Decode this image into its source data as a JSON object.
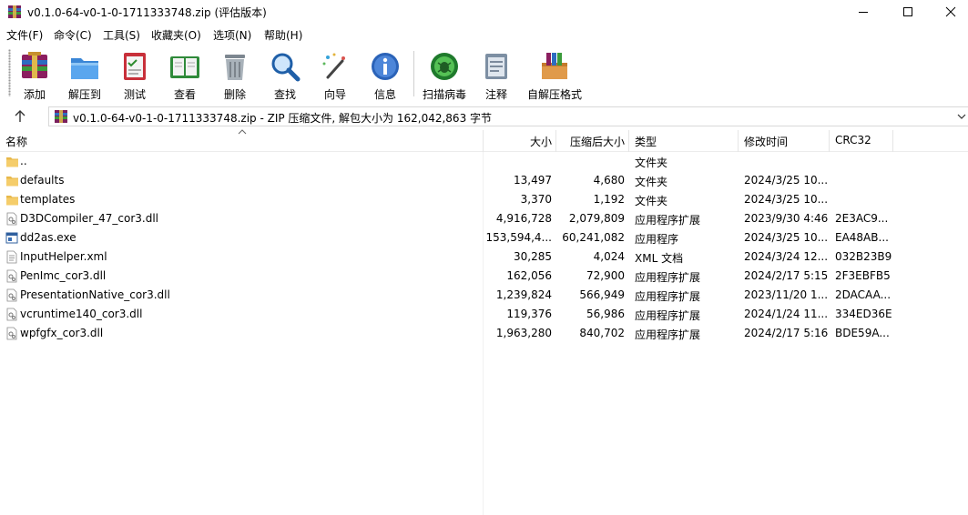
{
  "window": {
    "title": "v0.1.0-64-v0-1-0-1711333748.zip (评估版本)"
  },
  "menu": [
    "文件(F)",
    "命令(C)",
    "工具(S)",
    "收藏夹(O)",
    "选项(N)",
    "帮助(H)"
  ],
  "toolbar": {
    "add": "添加",
    "extract_to": "解压到",
    "test": "测试",
    "view": "查看",
    "delete": "删除",
    "find": "查找",
    "wizard": "向导",
    "info": "信息",
    "virus_scan": "扫描病毒",
    "comment": "注释",
    "sfx": "自解压格式"
  },
  "address": {
    "text": "v0.1.0-64-v0-1-0-1711333748.zip - ZIP 压缩文件, 解包大小为 162,042,863 字节"
  },
  "columns": {
    "name": "名称",
    "size": "大小",
    "packed": "压缩后大小",
    "type": "类型",
    "modified": "修改时间",
    "crc": "CRC32"
  },
  "files": [
    {
      "name": "..",
      "size": "",
      "packed": "",
      "type": "文件夹",
      "modified": "",
      "crc": "",
      "icon": "folder-icon"
    },
    {
      "name": "defaults",
      "size": "13,497",
      "packed": "4,680",
      "type": "文件夹",
      "modified": "2024/3/25 10...",
      "crc": "",
      "icon": "folder-icon"
    },
    {
      "name": "templates",
      "size": "3,370",
      "packed": "1,192",
      "type": "文件夹",
      "modified": "2024/3/25 10...",
      "crc": "",
      "icon": "folder-icon"
    },
    {
      "name": "D3DCompiler_47_cor3.dll",
      "size": "4,916,728",
      "packed": "2,079,809",
      "type": "应用程序扩展",
      "modified": "2023/9/30 4:46",
      "crc": "2E3AC9...",
      "icon": "dll-file-icon"
    },
    {
      "name": "dd2as.exe",
      "size": "153,594,4...",
      "packed": "60,241,082",
      "type": "应用程序",
      "modified": "2024/3/25 10...",
      "crc": "EA48AB...",
      "icon": "exe-file-icon"
    },
    {
      "name": "InputHelper.xml",
      "size": "30,285",
      "packed": "4,024",
      "type": "XML 文档",
      "modified": "2024/3/24 12...",
      "crc": "032B23B9",
      "icon": "xml-file-icon"
    },
    {
      "name": "PenImc_cor3.dll",
      "size": "162,056",
      "packed": "72,900",
      "type": "应用程序扩展",
      "modified": "2024/2/17 5:15",
      "crc": "2F3EBFB5",
      "icon": "dll-file-icon"
    },
    {
      "name": "PresentationNative_cor3.dll",
      "size": "1,239,824",
      "packed": "566,949",
      "type": "应用程序扩展",
      "modified": "2023/11/20 1...",
      "crc": "2DACAA...",
      "icon": "dll-file-icon"
    },
    {
      "name": "vcruntime140_cor3.dll",
      "size": "119,376",
      "packed": "56,986",
      "type": "应用程序扩展",
      "modified": "2024/1/24 11...",
      "crc": "334ED36E",
      "icon": "dll-file-icon"
    },
    {
      "name": "wpfgfx_cor3.dll",
      "size": "1,963,280",
      "packed": "840,702",
      "type": "应用程序扩展",
      "modified": "2024/2/17 5:16",
      "crc": "BDE59A...",
      "icon": "dll-file-icon"
    }
  ]
}
